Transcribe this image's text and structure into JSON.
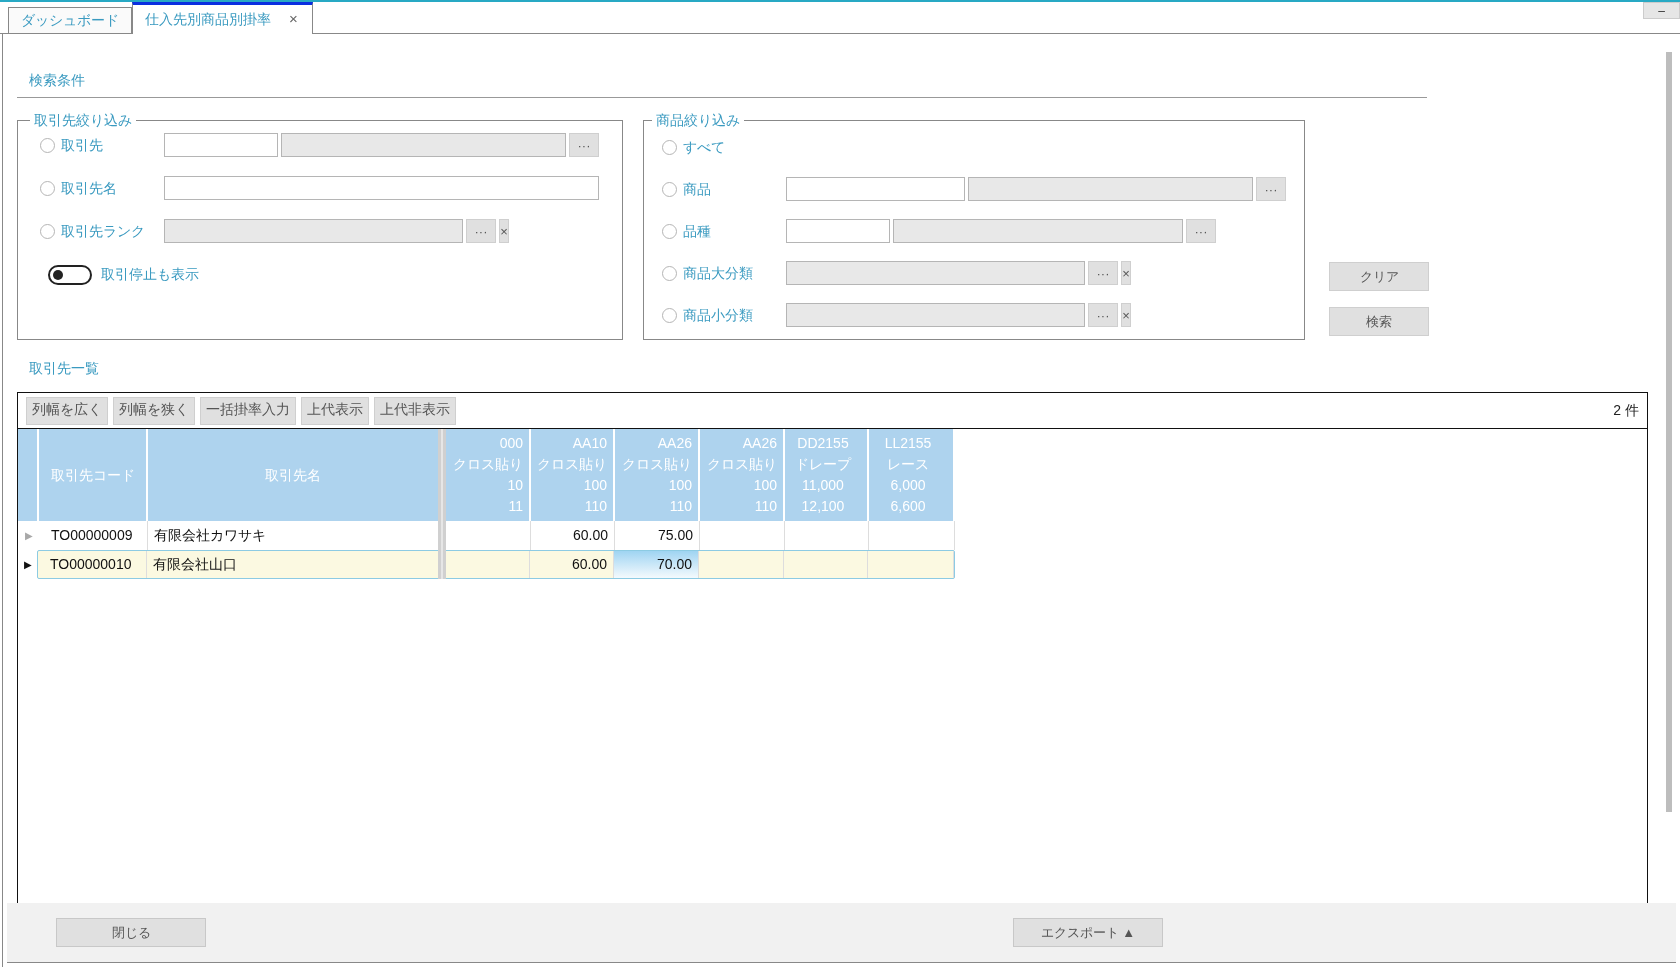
{
  "tabs": [
    {
      "label": "ダッシュボード",
      "selected": false
    },
    {
      "label": "仕入先別商品別掛率",
      "selected": true,
      "close": "×"
    }
  ],
  "window_button": "–",
  "search_section": {
    "title": "検索条件"
  },
  "supplier_filter": {
    "legend": "取引先絞り込み",
    "rows": [
      {
        "kind": "code_name",
        "label": "取引先",
        "selected": false,
        "picker": "···"
      },
      {
        "kind": "text",
        "label": "取引先名",
        "selected": false
      },
      {
        "kind": "picker_clear",
        "label": "取引先ランク",
        "selected": false,
        "picker": "···",
        "clear": "×"
      }
    ],
    "toggle": {
      "label": "取引停止も表示",
      "on": false
    }
  },
  "product_filter": {
    "legend": "商品絞り込み",
    "rows": [
      {
        "kind": "none",
        "label": "すべて",
        "selected": false
      },
      {
        "kind": "code_name",
        "label": "商品",
        "selected": false,
        "picker": "···"
      },
      {
        "kind": "code_name_short",
        "label": "品種",
        "selected": false,
        "picker": "···"
      },
      {
        "kind": "picker_clear",
        "label": "商品大分類",
        "selected": false,
        "picker": "···",
        "clear": "×"
      },
      {
        "kind": "picker_clear",
        "label": "商品小分類",
        "selected": false,
        "picker": "···",
        "clear": "×"
      }
    ]
  },
  "side_buttons": [
    "クリア",
    "検索"
  ],
  "list_section": {
    "title": "取引先一覧"
  },
  "toolbar": {
    "buttons": [
      "列幅を広く",
      "列幅を狭く",
      "一括掛率入力",
      "上代表示",
      "上代非表示"
    ],
    "count": "2 件"
  },
  "table": {
    "fixed_columns": [
      "取引先コード",
      "取引先名"
    ],
    "product_columns": [
      {
        "lines": [
          "000",
          "クロス貼り",
          "10",
          "11"
        ]
      },
      {
        "lines": [
          "AA10",
          "クロス貼り",
          "100",
          "110"
        ]
      },
      {
        "lines": [
          "AA26",
          "クロス貼り",
          "100",
          "110"
        ]
      },
      {
        "lines": [
          "AA26",
          "クロス貼り",
          "100",
          "110"
        ]
      },
      {
        "lines": [
          "DD2155",
          "ドレープ",
          "11,000",
          "12,100"
        ]
      },
      {
        "lines": [
          "LL2155",
          "レース",
          "6,000",
          "6,600"
        ]
      }
    ],
    "rows": [
      {
        "indicator": "▶",
        "code": "TO00000009",
        "name": "有限会社カワサキ",
        "selected": false,
        "cells": [
          {
            "current": false
          },
          {
            "text": "60.00",
            "current": false
          },
          {
            "text": "75.00",
            "current": false
          },
          {
            "current": false
          },
          {
            "current": false
          },
          {
            "current": false
          }
        ]
      },
      {
        "indicator": "▶",
        "code": "TO00000010",
        "name": "有限会社山口",
        "selected": true,
        "cells": [
          {
            "current": false
          },
          {
            "text": "60.00",
            "current": false
          },
          {
            "text": "70.00",
            "current": true
          },
          {
            "current": false
          },
          {
            "current": false
          },
          {
            "current": false
          }
        ]
      }
    ]
  },
  "footer": {
    "close": "閉じる",
    "export": "エクスポート ▲"
  }
}
